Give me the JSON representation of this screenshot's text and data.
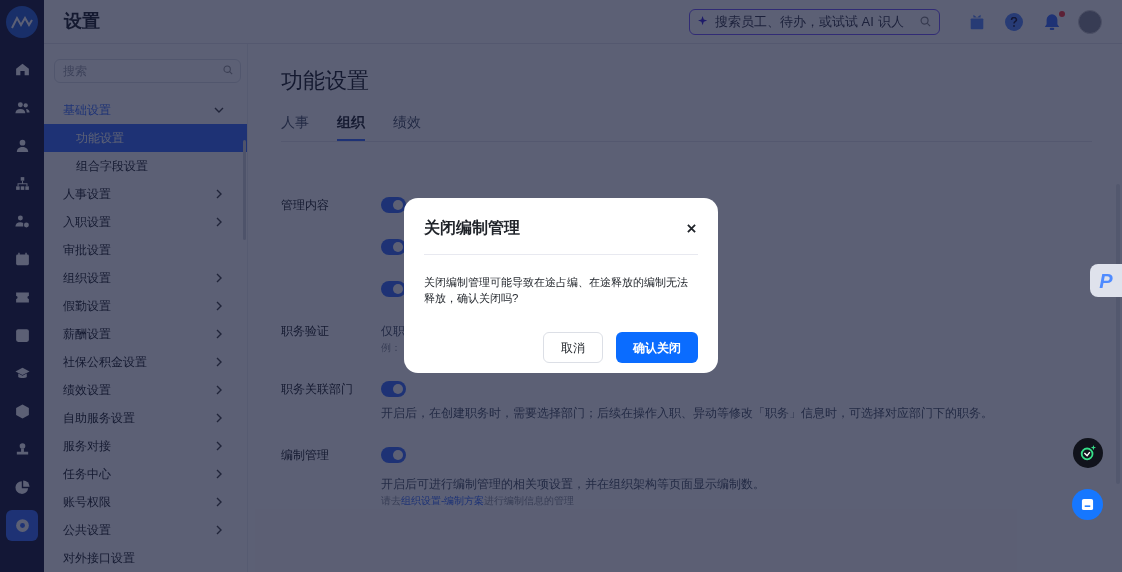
{
  "nav": {
    "items": [
      {
        "selected": false
      },
      {
        "selected": false
      },
      {
        "selected": false
      },
      {
        "selected": false
      },
      {
        "selected": false
      },
      {
        "selected": false
      },
      {
        "selected": false
      },
      {
        "selected": false
      },
      {
        "selected": false
      },
      {
        "selected": false
      },
      {
        "selected": false
      },
      {
        "selected": false
      },
      {
        "selected": true
      }
    ]
  },
  "header": {
    "title": "设置",
    "search": {
      "placeholder": "搜索员工、待办，或试试 AI 识人"
    },
    "has_unread_notifications": true
  },
  "sidebar": {
    "search": {
      "placeholder": "搜索"
    },
    "items": [
      {
        "label": "基础设置",
        "kind": "group",
        "expanded": true,
        "selected": true,
        "children": [
          {
            "label": "功能设置",
            "selected": true
          },
          {
            "label": "组合字段设置",
            "selected": false
          }
        ]
      },
      {
        "label": "人事设置",
        "kind": "group",
        "expanded": false,
        "selected": false
      },
      {
        "label": "入职设置",
        "kind": "group",
        "expanded": false,
        "selected": false
      },
      {
        "label": "审批设置",
        "kind": "link",
        "selected": false
      },
      {
        "label": "组织设置",
        "kind": "group",
        "expanded": false,
        "selected": false
      },
      {
        "label": "假勤设置",
        "kind": "group",
        "expanded": false,
        "selected": false
      },
      {
        "label": "薪酬设置",
        "kind": "group",
        "expanded": false,
        "selected": false
      },
      {
        "label": "社保公积金设置",
        "kind": "group",
        "expanded": false,
        "selected": false
      },
      {
        "label": "绩效设置",
        "kind": "group",
        "expanded": false,
        "selected": false
      },
      {
        "label": "自助服务设置",
        "kind": "group",
        "expanded": false,
        "selected": false
      },
      {
        "label": "服务对接",
        "kind": "group",
        "expanded": false,
        "selected": false
      },
      {
        "label": "任务中心",
        "kind": "group",
        "expanded": false,
        "selected": false
      },
      {
        "label": "账号权限",
        "kind": "group",
        "expanded": false,
        "selected": false
      },
      {
        "label": "公共设置",
        "kind": "group",
        "expanded": false,
        "selected": false
      },
      {
        "label": "对外接口设置",
        "kind": "link",
        "selected": false
      }
    ]
  },
  "page": {
    "title": "功能设置",
    "tabs": [
      {
        "label": "人事",
        "selected": false
      },
      {
        "label": "组织",
        "selected": true
      },
      {
        "label": "绩效",
        "selected": false
      }
    ],
    "settings": [
      {
        "label": "管理内容",
        "items": [
          {
            "kind": "toggle",
            "on": true
          },
          {
            "kind": "toggle",
            "on": true
          },
          {
            "kind": "toggle",
            "on": true
          }
        ]
      },
      {
        "label": "职务验证",
        "items": [
          {
            "kind": "text",
            "text": "仅职"
          },
          {
            "kind": "hint",
            "text": "例："
          }
        ]
      },
      {
        "label": "职务关联部门",
        "items": [
          {
            "kind": "toggle",
            "on": true
          },
          {
            "kind": "text",
            "text": "开启后，在创建职务时，需要选择部门；后续在操作入职、异动等修改「职务」信息时，可选择对应部门下的职务。"
          }
        ]
      },
      {
        "label": "编制管理",
        "items": [
          {
            "kind": "toggle",
            "on": true
          },
          {
            "kind": "text",
            "text": "开启后可进行编制管理的相关项设置，并在组织架构等页面显示编制数。"
          },
          {
            "kind": "note",
            "before": "请去",
            "link": "组织设置-编制方案",
            "after": "进行编制信息的管理"
          }
        ]
      }
    ]
  },
  "dialog": {
    "title": "关闭编制管理",
    "message": "关闭编制管理可能导致在途占编、在途释放的编制无法释放，确认关闭吗?",
    "buttons": [
      {
        "label": "取消",
        "kind": "secondary"
      },
      {
        "label": "确认关闭",
        "kind": "primary"
      }
    ]
  },
  "floating": {
    "badge_letter": "P"
  }
}
